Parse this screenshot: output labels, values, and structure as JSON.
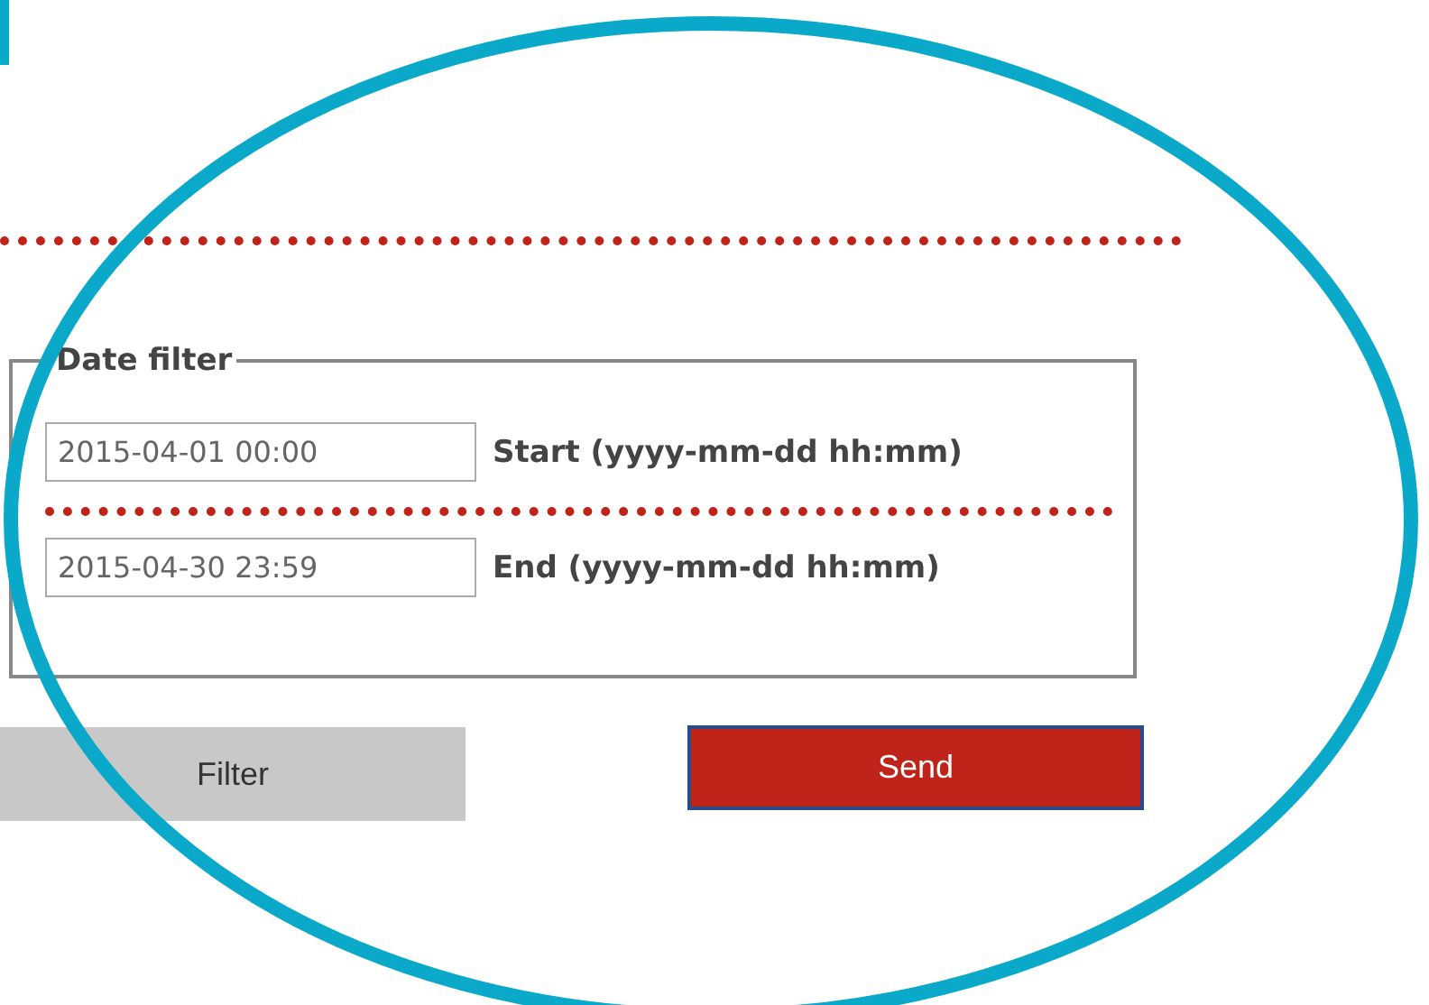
{
  "date_filter": {
    "legend": "Date filter",
    "fields": [
      {
        "value": "2015-04-01 00:00",
        "label": "Start (yyyy-mm-dd hh:mm)"
      },
      {
        "value": "2015-04-30 23:59",
        "label": "End (yyyy-mm-dd hh:mm)"
      }
    ]
  },
  "buttons": [
    {
      "label": "Filter",
      "kind": "secondary"
    },
    {
      "label": "Send",
      "kind": "primary"
    }
  ]
}
